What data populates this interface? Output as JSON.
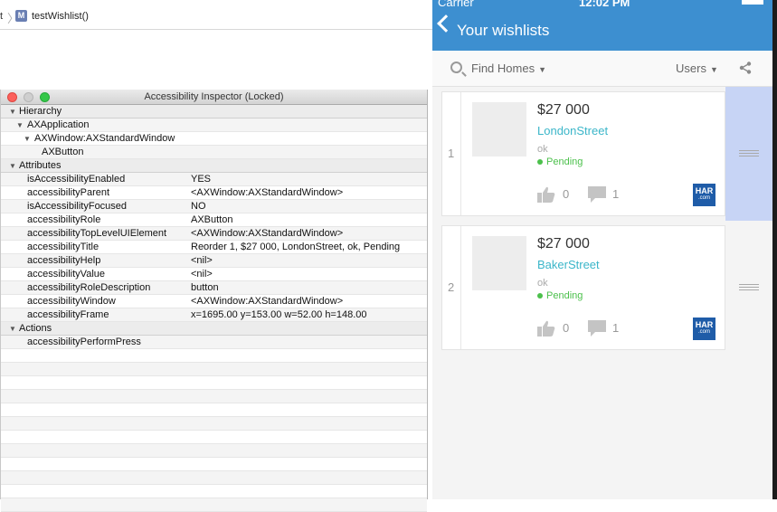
{
  "xcode": {
    "crumb_fragment": "t",
    "file_badge": "M",
    "crumb_label": "testWishlist()"
  },
  "inspector": {
    "title": "Accessibility Inspector (Locked)",
    "rows": {
      "hierarchy": "Hierarchy",
      "ax_application": "AXApplication",
      "ax_window": "AXWindow:AXStandardWindow",
      "ax_button": "AXButton",
      "attributes": "Attributes",
      "actions": "Actions",
      "perform_press": "accessibilityPerformPress"
    },
    "attributes": [
      {
        "key": "isAccessibilityEnabled",
        "value": "YES"
      },
      {
        "key": "accessibilityParent",
        "value": "<AXWindow:AXStandardWindow>"
      },
      {
        "key": "isAccessibilityFocused",
        "value": "NO"
      },
      {
        "key": "accessibilityRole",
        "value": "AXButton"
      },
      {
        "key": "accessibilityTopLevelUIElement",
        "value": "<AXWindow:AXStandardWindow>"
      },
      {
        "key": "accessibilityTitle",
        "value": "Reorder 1, $27 000, LondonStreet, ok, Pending"
      },
      {
        "key": "accessibilityHelp",
        "value": "<nil>"
      },
      {
        "key": "accessibilityValue",
        "value": "<nil>"
      },
      {
        "key": "accessibilityRoleDescription",
        "value": "button"
      },
      {
        "key": "accessibilityWindow",
        "value": "<AXWindow:AXStandardWindow>"
      },
      {
        "key": "accessibilityFrame",
        "value": "x=1695.00 y=153.00 w=52.00 h=148.00"
      }
    ]
  },
  "simulator": {
    "carrier": "Carrier",
    "time": "12:02 PM",
    "nav_title": "Your wishlists",
    "find_homes": "Find Homes",
    "users": "Users",
    "caret": "▼",
    "cards": [
      {
        "index": "1",
        "price": "$27 000",
        "street": "LondonStreet",
        "status_ok": "ok",
        "status": "Pending",
        "likes": "0",
        "comments": "1",
        "har_top": "HAR",
        "har_bottom": ".com"
      },
      {
        "index": "2",
        "price": "$27 000",
        "street": "BakerStreet",
        "status_ok": "ok",
        "status": "Pending",
        "likes": "0",
        "comments": "1",
        "har_top": "HAR",
        "har_bottom": ".com"
      }
    ]
  },
  "colors": {
    "nav_blue": "#3d8fd0",
    "street_teal": "#3bb6c9",
    "pending_green": "#4cc04c",
    "selected_handle": "#c7d4f5",
    "har_blue": "#1f5ca8"
  }
}
